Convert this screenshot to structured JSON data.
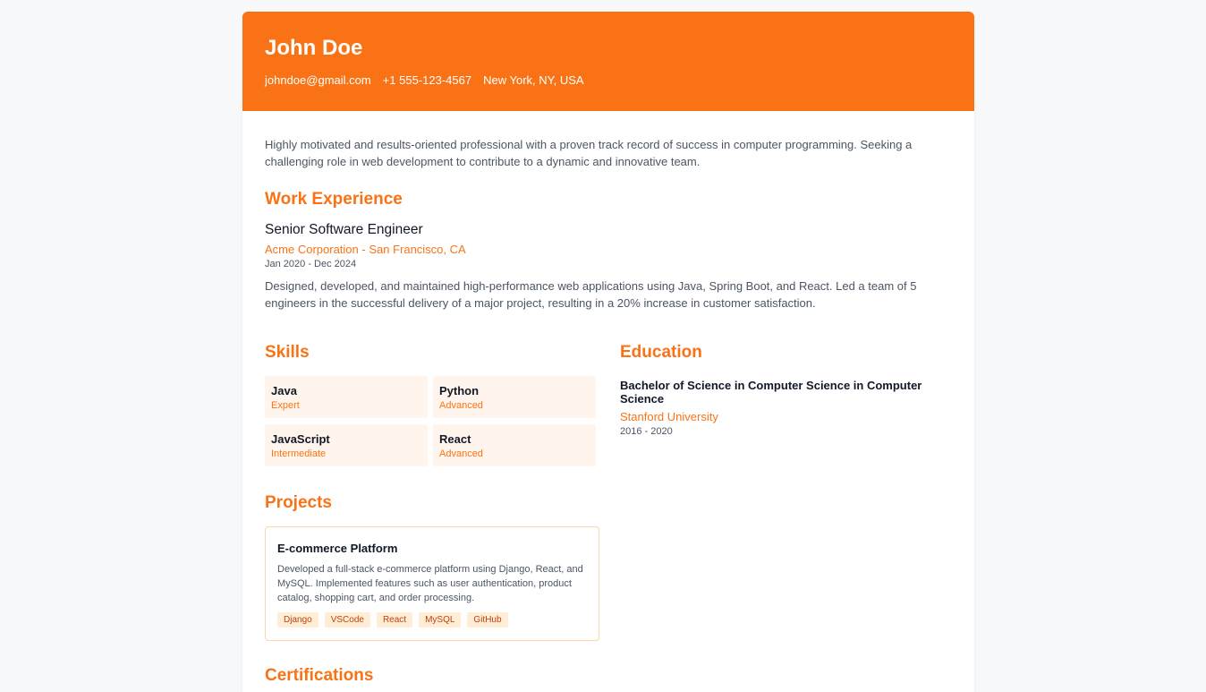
{
  "header": {
    "name": "John Doe",
    "email": "johndoe@gmail.com",
    "phone": "+1 555-123-4567",
    "location": "New York, NY, USA"
  },
  "summary": "Highly motivated and results-oriented professional with a proven track record of success in computer programming. Seeking a challenging role in web development to contribute to a dynamic and innovative team.",
  "work": {
    "title": "Work Experience",
    "items": [
      {
        "role": "Senior Software Engineer",
        "company": "Acme Corporation - San Francisco, CA",
        "dates": "Jan 2020 - Dec 2024",
        "description": "Designed, developed, and maintained high-performance web applications using Java, Spring Boot, and React. Led a team of 5 engineers in the successful delivery of a major project, resulting in a 20% increase in customer satisfaction."
      }
    ]
  },
  "skills": {
    "title": "Skills",
    "items": [
      {
        "name": "Java",
        "level": "Expert"
      },
      {
        "name": "Python",
        "level": "Advanced"
      },
      {
        "name": "JavaScript",
        "level": "Intermediate"
      },
      {
        "name": "React",
        "level": "Advanced"
      }
    ]
  },
  "education": {
    "title": "Education",
    "items": [
      {
        "degree": "Bachelor of Science in Computer Science in Computer Science",
        "school": "Stanford University",
        "years": "2016 - 2020"
      }
    ]
  },
  "projects": {
    "title": "Projects",
    "items": [
      {
        "name": "E-commerce Platform",
        "description": "Developed a full-stack e-commerce platform using Django, React, and MySQL. Implemented features such as user authentication, product catalog, shopping cart, and order processing.",
        "tags": [
          "Django",
          "VSCode",
          "React",
          "MySQL",
          "GitHub"
        ]
      }
    ]
  },
  "certifications": {
    "title": "Certifications"
  },
  "colors": {
    "accent": "#f97316",
    "background": "#f7f8fa",
    "skill_bg": "#fff5ec",
    "tag_bg": "#ffedd5"
  }
}
